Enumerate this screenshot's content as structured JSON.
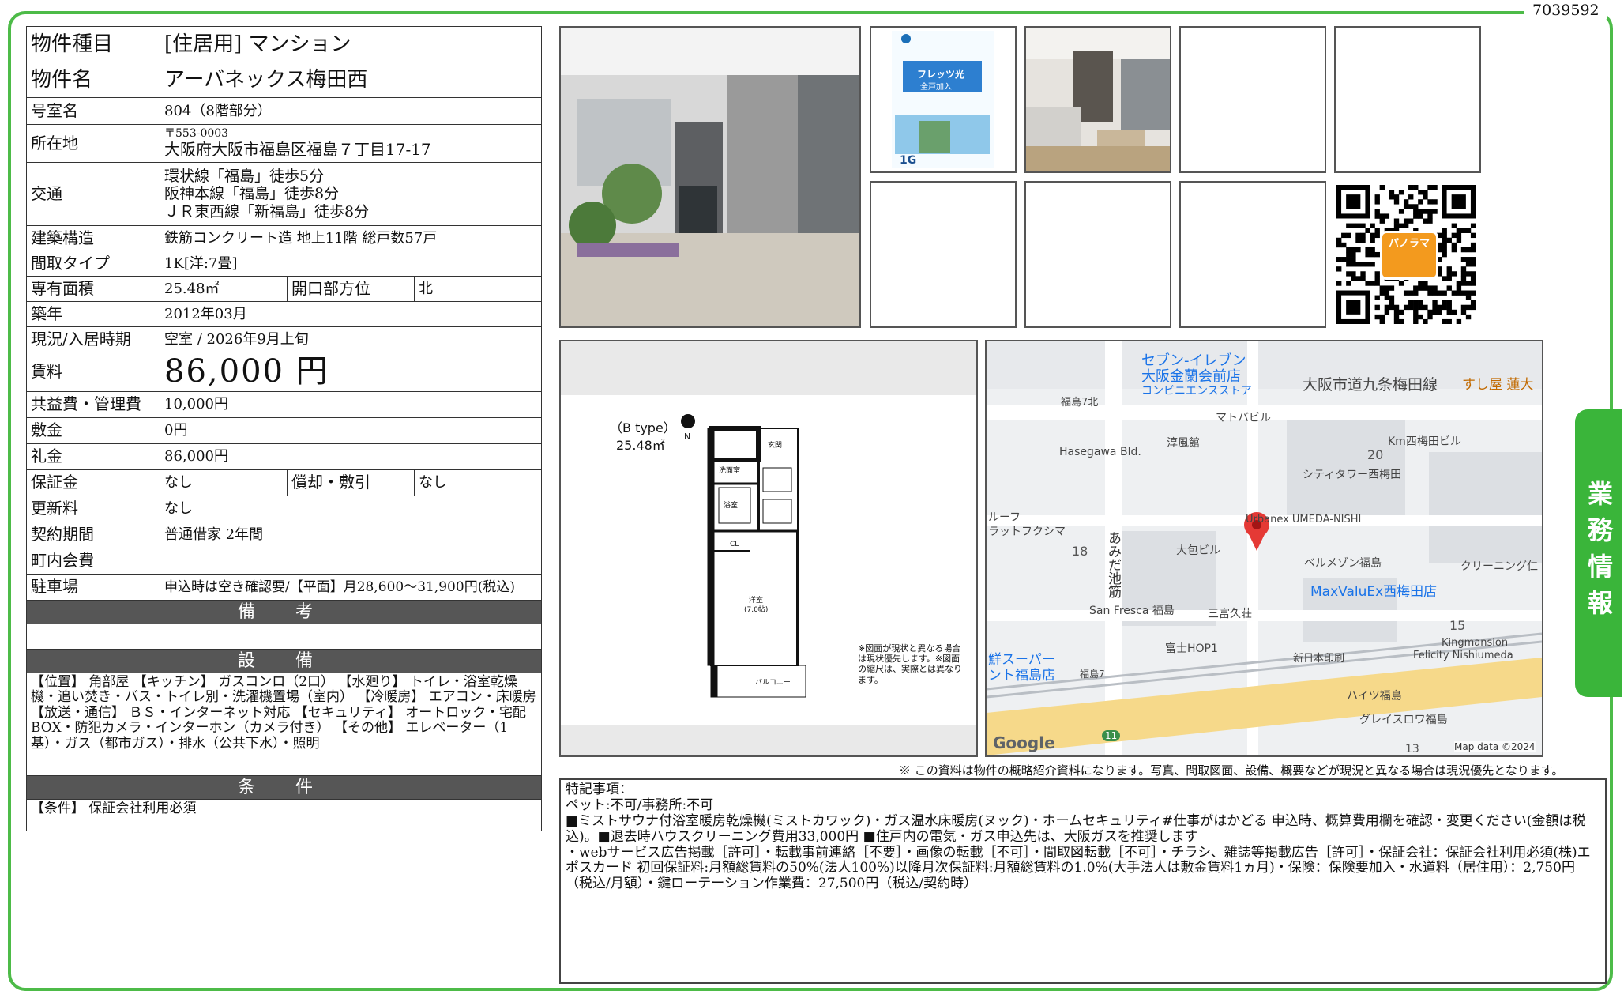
{
  "doc_id": "7039592",
  "side_tab": "業務情報",
  "property": {
    "type_label": "物件種目",
    "type_value": "[住居用]  マンション",
    "name_label": "物件名",
    "name_value": "アーバネックス梅田西",
    "room_label": "号室名",
    "room_value": "804（8階部分）",
    "address_label": "所在地",
    "postal": "〒553-0003",
    "address": "大阪府大阪市福島区福島７丁目17-17",
    "access_label": "交通",
    "access": [
      "環状線「福島」徒歩5分",
      "阪神本線「福島」徒歩8分",
      "ＪＲ東西線「新福島」徒歩8分"
    ],
    "structure_label": "建築構造",
    "structure_value": "鉄筋コンクリート造 地上11階 総戸数57戸",
    "layout_label": "間取タイプ",
    "layout_value": "1K[洋:7畳]",
    "area_label": "専有面積",
    "area_value": "25.48㎡",
    "direction_label": "開口部方位",
    "direction_value": "北",
    "built_label": "築年",
    "built_value": "2012年03月",
    "status_label": "現況/入居時期",
    "status_value": "空室  /  2026年9月上旬",
    "rent_label": "賃料",
    "rent_value": "86,000 円",
    "fee_label": "共益費・管理費",
    "fee_value": "10,000円",
    "deposit_label": "敷金",
    "deposit_value": "0円",
    "key_money_label": "礼金",
    "key_money_value": "86,000円",
    "guarantee_label": "保証金",
    "guarantee_value": "なし",
    "amort_label": "償却・敷引",
    "amort_value": "なし",
    "renewal_label": "更新料",
    "renewal_value": "なし",
    "contract_label": "契約期間",
    "contract_value": "普通借家 2年間",
    "assoc_label": "町内会費",
    "assoc_value": "",
    "parking_label": "駐車場",
    "parking_value": "申込時は空き確認要/【平面】月28,600～31,900円(税込)"
  },
  "sections": {
    "remarks_title": "備 考",
    "equipment_title": "設 備",
    "equipment_text": "【位置】 角部屋 【キッチン】 ガスコンロ（2口） 【水廻り】 トイレ・浴室乾燥機・追い焚き・バス・トイレ別・洗濯機置場（室内） 【冷暖房】 エアコン・床暖房 【放送・通信】 ＢＳ・インターネット対応 【セキュリティ】 オートロック・宅配BOX・防犯カメラ・インターホン（カメラ付き） 【その他】 エレベーター（1基）・ガス（都市ガス）・排水（公共下水）・照明",
    "conditions_title": "条 件",
    "conditions_text": "【条件】 保証会社利用必須"
  },
  "floorplan": {
    "type_label": "（B type）",
    "area": "25.48㎡",
    "north": "N",
    "rooms": [
      "洗面室",
      "浴室",
      "玄関",
      "CL",
      "洋室",
      "(7.0帖)",
      "バルコニー"
    ],
    "note": "※図面が現状と異なる場合は現状優先します。※図面の縮尺は、実際とは異なります。"
  },
  "map": {
    "labels": [
      "セブン-イレブン",
      "大阪金蘭会前店",
      "コンビニエンスストア",
      "大阪市道九条梅田線",
      "すし屋 蓮大",
      "福島7北",
      "マトバビル",
      "淳風館",
      "Km西梅田ビル",
      "Hasegawa Bld.",
      "20",
      "シティタワー西梅田",
      "Urbanex UMEDA-NISHI",
      "ルーフ",
      "ラットフクシマ",
      "18",
      "大包ビル",
      "ベルメゾン福島",
      "クリーニング仁",
      "MaxValuEx西梅田店",
      "あみだ池筋",
      "San Fresca 福島",
      "三富久荘",
      "15",
      "Kingmansion",
      "Felicity Nishiumeda",
      "富士HOP1",
      "新日本印刷",
      "鮮スーパー",
      "ント福島店",
      "福島7",
      "ハイツ福島",
      "グレイスロワ福島",
      "11",
      "13",
      "Google",
      "Map data ©2024"
    ]
  },
  "photo_note": "※ この資料は物件の概略紹介資料になります。写真、間取図面、設備、概要などが現況と異なる場合は現況優先となります。",
  "flyer": {
    "line1": "フレッツ光",
    "line2": "全戸加入",
    "speed": "1G"
  },
  "qr_label": "パノラマ",
  "special": {
    "title": "特記事項：",
    "lines": [
      "ペット:不可/事務所:不可",
      "■ミストサウナ付浴室暖房乾燥機(ミストカワック)・ガス温水床暖房(ヌック)・ホームセキュリティ#仕事がはかどる 申込時、概算費用欄を確認・変更ください(金額は税込)。■退去時ハウスクリーニング費用33,000円 ■住戸内の電気・ガス申込先は、大阪ガスを推奨します",
      "・webサービス広告掲載［許可］・転載事前連絡［不要］・画像の転載［不可］・間取図転載［不可］・チラシ、雑誌等掲載広告［許可］・保証会社：保証会社利用必須(株)エポスカード 初回保証料:月額総賃料の50%(法人100%)以降月次保証料:月額総賃料の1.0%(大手法人は敷金賃料1ヵ月)・保険：保険要加入・水道料（居住用）：2,750円（税込/月額）・鍵ローテーション作業費：27,500円（税込/契約時）"
    ]
  }
}
